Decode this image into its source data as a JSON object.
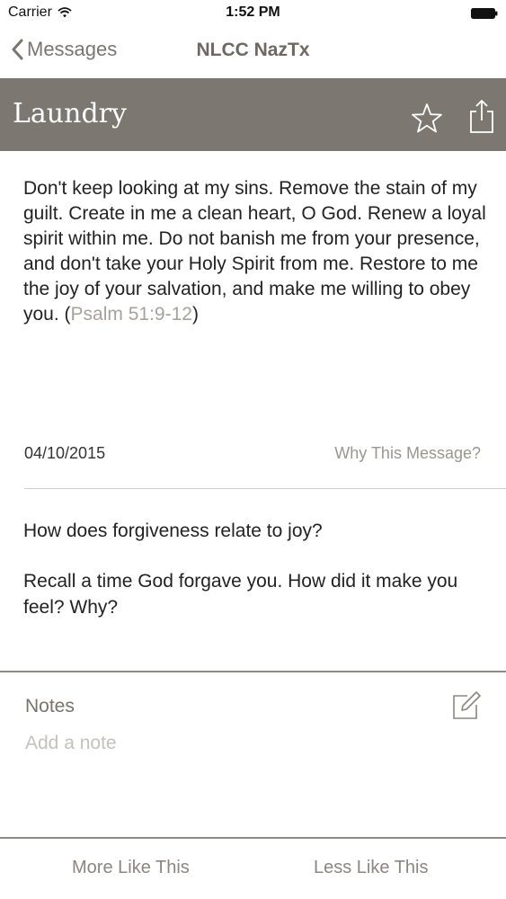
{
  "status_bar": {
    "carrier": "Carrier",
    "time": "1:52 PM",
    "wifi_icon": "wifi-icon",
    "battery_icon": "battery-icon"
  },
  "nav": {
    "back_label": "Messages",
    "title": "NLCC NazTx"
  },
  "category": {
    "title": "Laundry",
    "star_icon": "star-icon",
    "share_icon": "share-icon",
    "background": "#7c7771"
  },
  "message": {
    "text": "Don't keep looking at my sins.  Remove the stain of my guilt. Create in me a clean heart, O God. Renew a loyal spirit within me. Do not banish me from your presence, and don't take your Holy Spirit from me. Restore to me the joy of your salvation, and make me willing to obey you. (",
    "reference": "Psalm 51:9-12",
    "text_end": ")",
    "date": "04/10/2015",
    "why_label": "Why This Message?"
  },
  "questions": [
    "How does forgiveness relate to joy?",
    "Recall a time God forgave you. How did it make you feel?  Why?"
  ],
  "notes": {
    "label": "Notes",
    "placeholder": "Add a note",
    "value": "",
    "edit_icon": "compose-icon"
  },
  "toolbar": {
    "more_label": "More Like This",
    "less_label": "Less Like This"
  }
}
